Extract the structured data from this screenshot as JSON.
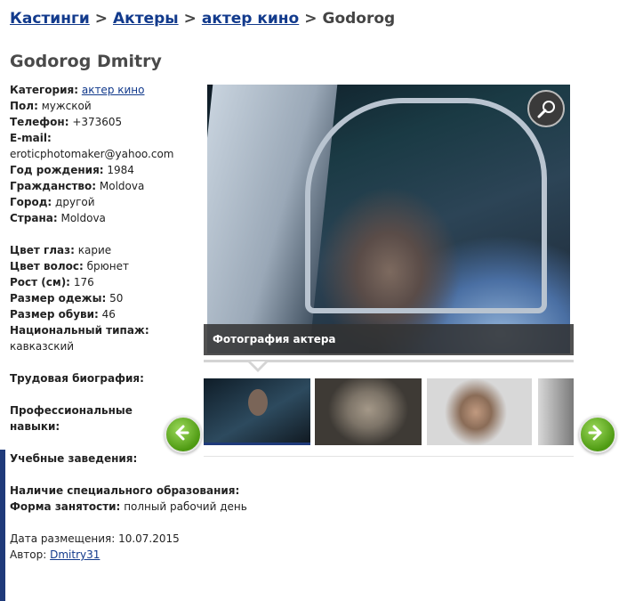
{
  "breadcrumb": {
    "items": [
      "Кастинги",
      "Актеры",
      "актер кино"
    ],
    "separator": ">",
    "current": "Godorog"
  },
  "title": "Godorog Dmitry",
  "info": {
    "category_label": "Категория:",
    "category_value": "актер кино",
    "gender_label": "Пол:",
    "gender_value": "мужской",
    "phone_label": "Телефон:",
    "phone_value": "+373605",
    "email_label": "E-mail:",
    "email_value": "eroticphotomaker@yahoo.com",
    "birth_label": "Год рождения:",
    "birth_value": "1984",
    "citizenship_label": "Гражданство:",
    "citizenship_value": "Moldova",
    "city_label": "Город:",
    "city_value": "другой",
    "country_label": "Страна:",
    "country_value": "Moldova",
    "eyes_label": "Цвет глаз:",
    "eyes_value": "карие",
    "hair_label": "Цвет волос:",
    "hair_value": "брюнет",
    "height_label": "Рост (см):",
    "height_value": "176",
    "clothes_label": "Размер одежы:",
    "clothes_value": "50",
    "shoes_label": "Размер обуви:",
    "shoes_value": "46",
    "type_label": "Национальный типаж:",
    "type_value": "кавказский",
    "bio_label": "Трудовая биография:",
    "skills_label_1": "Профессиональные",
    "skills_label_2": "навыки:",
    "schools_label": "Учебные заведения:",
    "education_label": "Наличие специального образования:",
    "employment_label": "Форма занятости:",
    "employment_value": "полный рабочий день",
    "posted_text": "Дата размещения: 10.07.2015",
    "author_label": "Автор:",
    "author_value": "Dmitry31"
  },
  "gallery": {
    "caption": "Фотография актера",
    "zoom_icon": "magnifier-icon",
    "prev_icon": "arrow-left-icon",
    "next_icon": "arrow-right-icon",
    "thumbnail_count": 4
  },
  "colors": {
    "link": "#123a8c",
    "accent": "#1f3a7a",
    "arrow_green": "#4e9a12"
  }
}
